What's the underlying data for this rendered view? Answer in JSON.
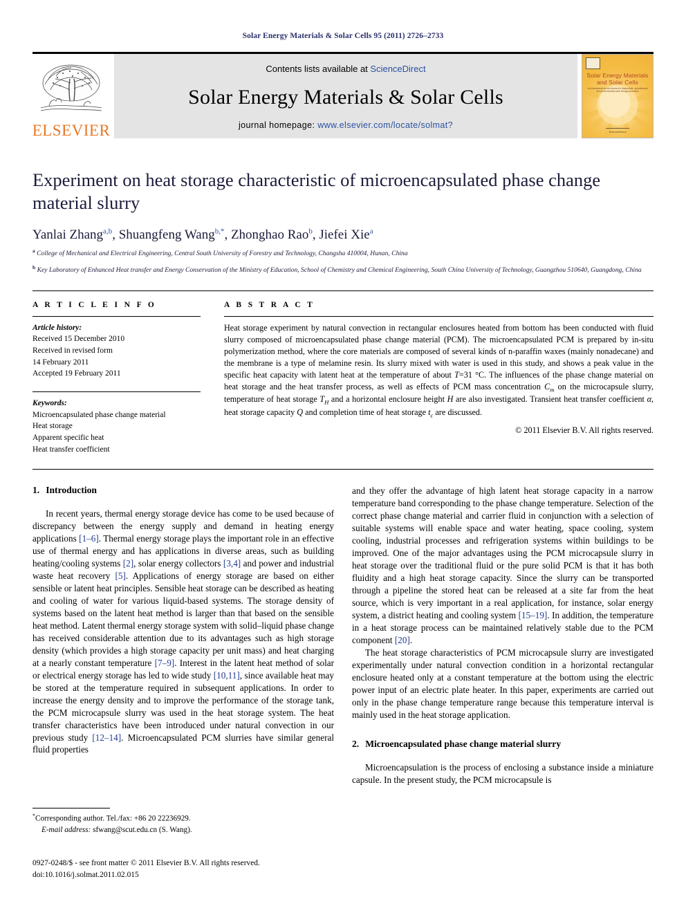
{
  "running_head": "Solar Energy Materials & Solar Cells 95 (2011) 2726–2733",
  "masthead": {
    "publisher_name": "ELSEVIER",
    "contents_prefix": "Contents lists available at ",
    "contents_link": "ScienceDirect",
    "journal_title": "Solar Energy Materials & Solar Cells",
    "homepage_label": "journal homepage: ",
    "homepage_url": "www.elsevier.com/locate/solmat?",
    "cover": {
      "title_line1": "Solar Energy Materials",
      "title_line2": "and Solar Cells",
      "subtitle": "An international journal devoted to photovoltaic, photothermal and photochemical solar energy conversion",
      "footer": "ScienceDirect"
    }
  },
  "article": {
    "title": "Experiment on heat storage characteristic of microencapsulated phase change material slurry",
    "authors": [
      {
        "name": "Yanlai Zhang",
        "sup": "a,b",
        "sep": ", "
      },
      {
        "name": "Shuangfeng Wang",
        "sup": "b,*",
        "sep": ", "
      },
      {
        "name": "Zhonghao Rao",
        "sup": "b",
        "sep": ", "
      },
      {
        "name": "Jiefei Xie",
        "sup": "a",
        "sep": ""
      }
    ],
    "affiliations": [
      {
        "marker": "a",
        "text": "College of Mechanical and Electrical Engineering, Central South University of Forestry and Technology, Changsha 410004, Hunan, China"
      },
      {
        "marker": "b",
        "text": "Key Laboratory of Enhanced Heat transfer and Energy Conservation of the Ministry of Education, School of Chemistry and Chemical Engineering, South China University of Technology, Guangzhou 510640, Guangdong, China"
      }
    ]
  },
  "article_info": {
    "heading": "A R T I C L E   I N F O",
    "history_label": "Article history:",
    "history": [
      "Received 15 December 2010",
      "Received in revised form",
      "14 February 2011",
      "Accepted 19 February 2011"
    ],
    "keywords_label": "Keywords:",
    "keywords": [
      "Microencapsulated phase change material",
      "Heat storage",
      "Apparent specific heat",
      "Heat transfer coefficient"
    ]
  },
  "abstract": {
    "heading": "A B S T R A C T",
    "paragraphs": [
      "Heat storage experiment by natural convection in rectangular enclosures heated from bottom has been conducted with fluid slurry composed of microencapsulated phase change material (PCM). The microencapsulated PCM is prepared by in-situ polymerization method, where the core materials are composed of several kinds of n-paraffin waxes (mainly nonadecane) and the membrane is a type of melamine resin. Its slurry mixed with water is used in this study, and shows a peak value in the specific heat capacity with latent heat at the temperature of about T=31 °C. The influences of the phase change material on heat storage and the heat transfer process, as well as effects of PCM mass concentration Cm on the microcapsule slurry, temperature of heat storage TH and a horizontal enclosure height H are also investigated. Transient heat transfer coefficient α, heat storage capacity Q and completion time of heat storage tc are discussed."
    ],
    "copyright": "© 2011 Elsevier B.V. All rights reserved."
  },
  "sections": [
    {
      "number": "1.",
      "title": "Introduction",
      "paragraphs": [
        "In recent years, thermal energy storage device has come to be used because of discrepancy between the energy supply and demand in heating energy applications [1–6]. Thermal energy storage plays the important role in an effective use of thermal energy and has applications in diverse areas, such as building heating/cooling systems [2], solar energy collectors [3,4] and power and industrial waste heat recovery [5]. Applications of energy storage are based on either sensible or latent heat principles. Sensible heat storage can be described as heating and cooling of water for various liquid-based systems. The storage density of systems based on the latent heat method is larger than that based on the sensible heat method. Latent thermal energy storage system with solid–liquid phase change has received considerable attention due to its advantages such as high storage density (which provides a high storage capacity per unit mass) and heat charging at a nearly constant temperature [7–9]. Interest in the latent heat method of solar or electrical energy storage has led to wide study [10,11], since available heat may be stored at the temperature required in subsequent applications. In order to increase the energy density and to improve the performance of the storage tank, the PCM microcapsule slurry was used in the heat storage system. The heat transfer characteristics have been introduced under natural convection in our previous study [12–14]. Microencapsulated PCM slurries have similar general fluid properties and they offer the advantage of high latent heat storage capacity in a narrow temperature band corresponding to the phase change temperature. Selection of the correct phase change material and carrier fluid in conjunction with a selection of suitable systems will enable space and water heating, space cooling, system cooling, industrial processes and refrigeration systems within buildings to be improved. One of the major advantages using the PCM microcapsule slurry in heat storage over the traditional fluid or the pure solid PCM is that it has both fluidity and a high heat storage capacity. Since the slurry can be transported through a pipeline the stored heat can be released at a site far from the heat source, which is very important in a real application, for instance, solar energy system, a district heating and cooling system [15–19]. In addition, the temperature in a heat storage process can be maintained relatively stable due to the PCM component [20].",
        "The heat storage characteristics of PCM microcapsule slurry are investigated experimentally under natural convection condition in a horizontal rectangular enclosure heated only at a constant temperature at the bottom using the electric power input of an electric plate heater. In this paper, experiments are carried out only in the phase change temperature range because this temperature interval is mainly used in the heat storage application."
      ]
    },
    {
      "number": "2.",
      "title": "Microencapsulated phase change material slurry",
      "paragraphs": [
        "Microencapsulation is the process of enclosing a substance inside a miniature capsule. In the present study, the PCM microcapsule is"
      ]
    }
  ],
  "footnote": {
    "corresponding": "Corresponding author. Tel./fax: +86 20 22236929.",
    "email_label": "E-mail address:",
    "email": "sfwang@scut.edu.cn (S. Wang)."
  },
  "imprint": {
    "line1": "0927-0248/$ - see front matter © 2011 Elsevier B.V. All rights reserved.",
    "line2": "doi:10.1016/j.solmat.2011.02.015"
  },
  "colors": {
    "link": "#2850a0",
    "elsevier_orange": "#e87722",
    "title_navy": "#1b1b3a",
    "band_grey": "#e4e4e4"
  }
}
